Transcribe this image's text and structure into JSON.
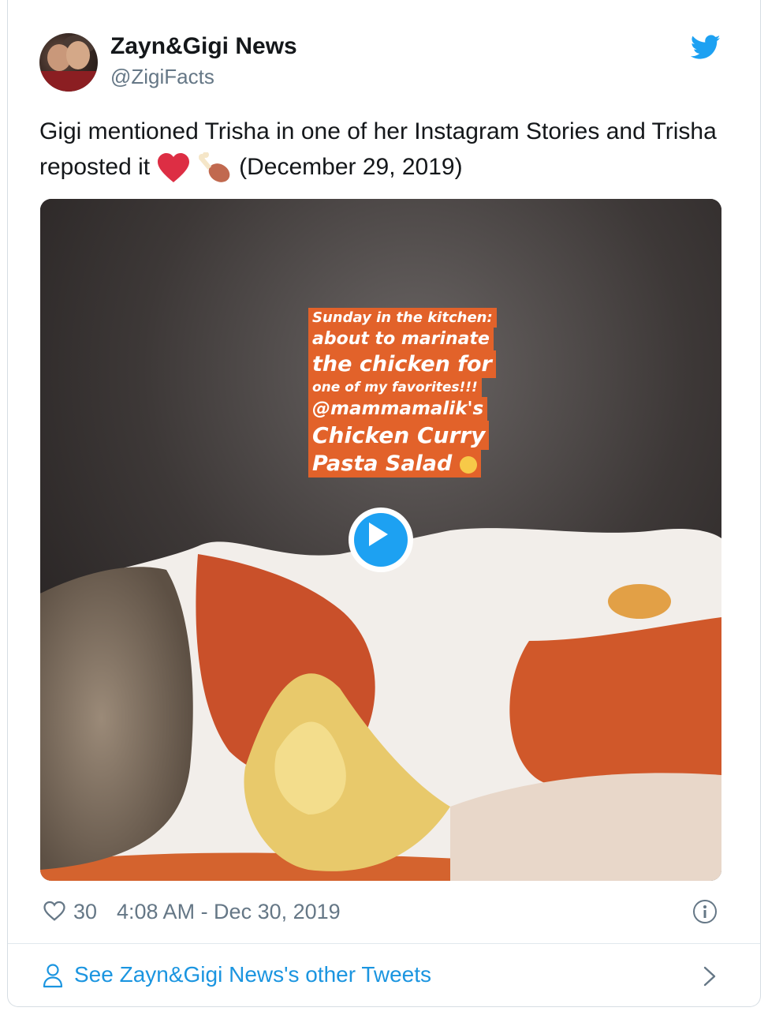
{
  "tweet": {
    "author_name": "Zayn&Gigi News",
    "author_handle": "@ZigiFacts",
    "text_part1": "Gigi mentioned Trisha in one of her Instagram Stories and Trisha reposted it",
    "text_part2": "(December 29, 2019)",
    "emojis": [
      "red-heart",
      "poultry-leg"
    ],
    "like_count": "30",
    "timestamp": "4:08 AM - Dec 30, 2019",
    "other_tweets_label": "See Zayn&Gigi News's other Tweets"
  },
  "media": {
    "story_lines": [
      "Sunday in the kitchen:",
      "about to marinate",
      "the chicken for",
      "one of my favorites!!!",
      "@mammamalik's",
      "Chicken Curry",
      "Pasta Salad"
    ],
    "story_emoji": "smiling-face"
  },
  "icons": {
    "logo": "twitter-bird-icon",
    "like": "heart-icon",
    "info": "info-icon",
    "profile": "person-icon",
    "next": "chevron-right-icon",
    "play": "play-icon"
  },
  "colors": {
    "twitter_blue": "#1da1f2",
    "link_blue": "#1b95e0",
    "text": "#14171a",
    "secondary": "#657786",
    "story_bg": "#e2622a"
  }
}
